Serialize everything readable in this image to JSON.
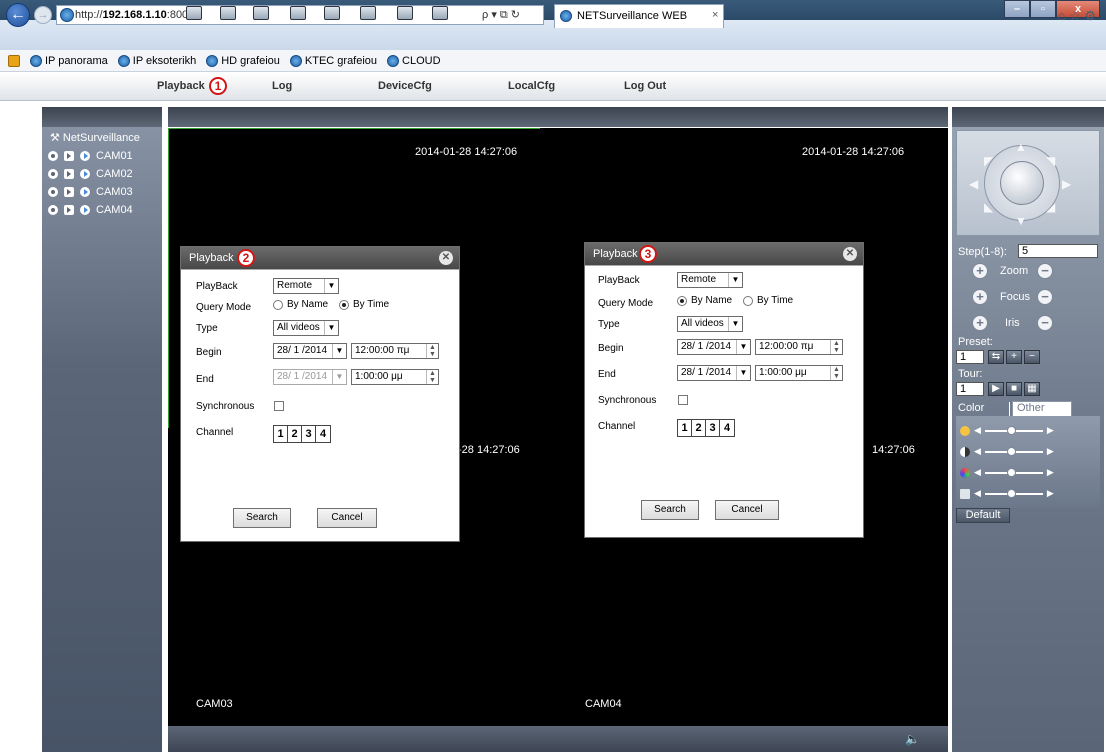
{
  "browser": {
    "url_prefix": "http://",
    "url_host": "192.168.1.10",
    "url_rest": ":8007/",
    "address_tools": "ρ ▾ ⧉ ↻",
    "tab_title": "NETSurveillance WEB",
    "tab_close": "×",
    "nav_icons": "⌂ ☆ ⚙",
    "window_min": "–",
    "window_max": "▫",
    "window_close": "x",
    "back": "←",
    "forward": "→",
    "favorites": [
      "IP panorama",
      "IP eksoterikh",
      "HD grafeiou",
      "KTEC grafeiou",
      "CLOUD"
    ]
  },
  "menu": {
    "items": [
      "Playback",
      "Log",
      "DeviceCfg",
      "LocalCfg",
      "Log Out"
    ],
    "badge": "1"
  },
  "tree": {
    "root": "NetSurveillance",
    "cameras": [
      "CAM01",
      "CAM02",
      "CAM03",
      "CAM04"
    ]
  },
  "video": {
    "ts1": "2014-01-28 14:27:06",
    "ts2": "2014-01-28 14:27:06",
    "ts3": "-28 14:27:06",
    "ts4": "14:27:06",
    "cam3": "CAM03",
    "cam4": "CAM04"
  },
  "ptz": {
    "step_label": "Step(1-8):",
    "step_value": "5",
    "zoom": "Zoom",
    "focus": "Focus",
    "iris": "Iris",
    "preset_label": "Preset:",
    "preset_value": "1",
    "tour_label": "Tour:",
    "tour_value": "1",
    "tab_color": "Color",
    "tab_other": "Other",
    "default_btn": "Default"
  },
  "dialog_left": {
    "title": "Playback",
    "badge": "2",
    "playback_label": "PlayBack",
    "playback_value": "Remote",
    "query_label": "Query Mode",
    "by_name": "By Name",
    "by_time": "By Time",
    "selected_mode": "By Time",
    "type_label": "Type",
    "type_value": "All videos",
    "begin_label": "Begin",
    "begin_date": "28/ 1 /2014",
    "begin_time": "12:00:00 πμ",
    "end_label": "End",
    "end_date": "28/ 1 /2014",
    "end_time": "1:00:00 μμ",
    "sync_label": "Synchronous",
    "channel_label": "Channel",
    "channels": [
      "1",
      "2",
      "3",
      "4"
    ],
    "search": "Search",
    "cancel": "Cancel"
  },
  "dialog_right": {
    "title": "Playback",
    "badge": "3",
    "playback_label": "PlayBack",
    "playback_value": "Remote",
    "query_label": "Query Mode",
    "by_name": "By Name",
    "by_time": "By Time",
    "selected_mode": "By Name",
    "type_label": "Type",
    "type_value": "All videos",
    "begin_label": "Begin",
    "begin_date": "28/ 1 /2014",
    "begin_time": "12:00:00 πμ",
    "end_label": "End",
    "end_date": "28/ 1 /2014",
    "end_time": "1:00:00 μμ",
    "sync_label": "Synchronous",
    "channel_label": "Channel",
    "channels": [
      "1",
      "2",
      "3",
      "4"
    ],
    "search": "Search",
    "cancel": "Cancel"
  }
}
